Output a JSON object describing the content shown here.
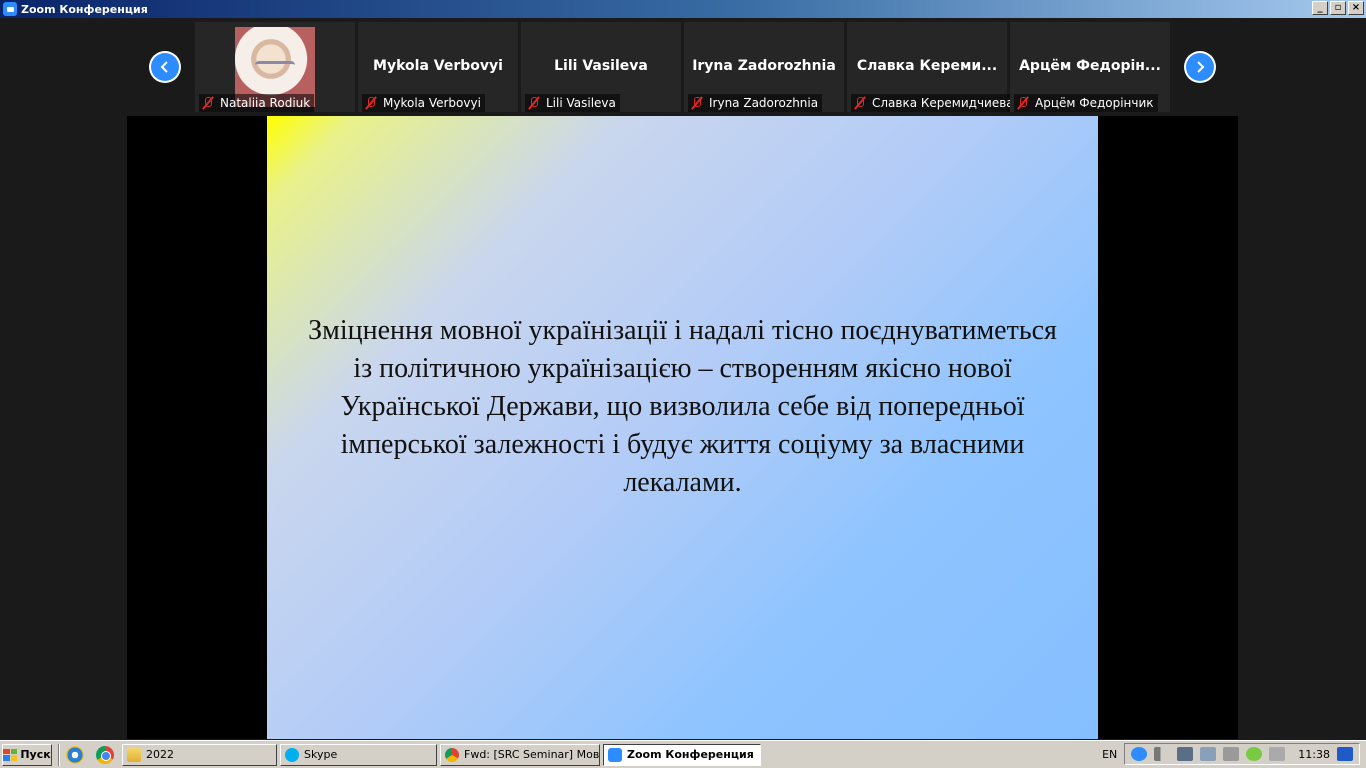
{
  "window": {
    "title": "Zoom Конференция",
    "controls": [
      "_",
      "▫",
      "×"
    ]
  },
  "participants": [
    {
      "display": "",
      "label": "Nataliia Rodiuk",
      "has_video": true
    },
    {
      "display": "Mykola Verbovyi",
      "label": "Mykola Verbovyi"
    },
    {
      "display": "Lili Vasileva",
      "label": "Lili Vasileva"
    },
    {
      "display": "Iryna Zadorozhnia",
      "label": "Iryna Zadorozhnia"
    },
    {
      "display": "Славка  Кереми...",
      "label": "Славка Керемидчиева"
    },
    {
      "display": "Арцём  Федорін...",
      "label": "Арцём Федорінчик"
    }
  ],
  "slide": {
    "text": "Зміцнення мовної українізації і надалі тісно поєднуватиметься із політичною українізацією – створенням якісно нової Української Держави, що визволила себе від попередньої імперської залежності і будує життя соціуму за власними лекалами."
  },
  "taskbar": {
    "start_label": "Пуск",
    "tasks": [
      {
        "label": "2022",
        "icon": "folder-icon"
      },
      {
        "label": "Skype",
        "icon": "skype-icon"
      },
      {
        "label": "Fwd: [SRC Seminar] Мов...",
        "icon": "chrome-icon"
      },
      {
        "label": "Zoom Конференция",
        "icon": "zoom-icon",
        "active": true
      }
    ],
    "language": "EN",
    "clock": "11:38"
  },
  "colors": {
    "zoom_blue": "#2d8cff",
    "mute_red": "#e02828",
    "titlebar": "#0a246a"
  }
}
